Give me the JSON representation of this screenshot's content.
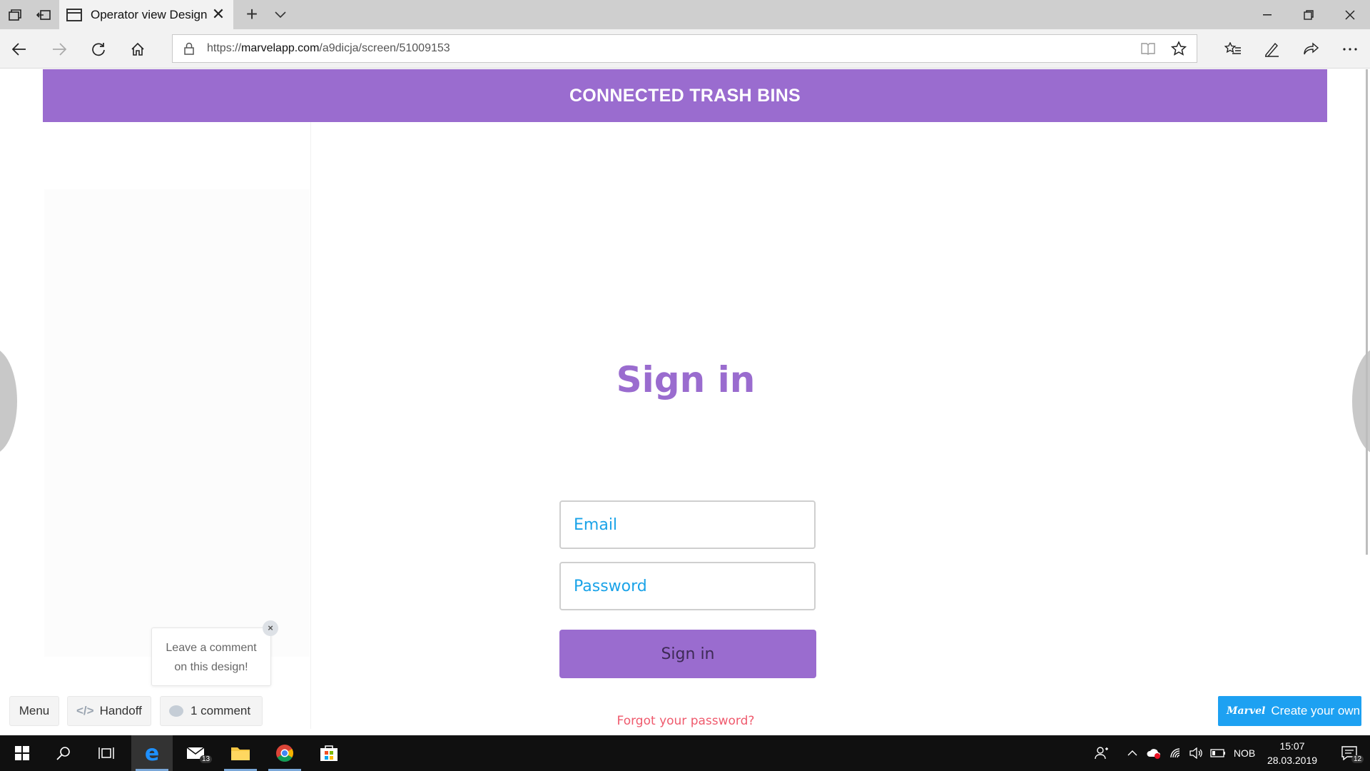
{
  "browser": {
    "tab_title": "Operator view Design",
    "url_prefix": "https://",
    "url_host": "marvelapp.com",
    "url_path": "/a9dicja/screen/51009153"
  },
  "app": {
    "header_title": "CONNECTED TRASH BINS",
    "signin_title": "Sign in",
    "email_placeholder": "Email",
    "password_placeholder": "Password",
    "signin_button": "Sign in",
    "forgot_link": "Forgot your password?"
  },
  "marvel": {
    "tooltip_line1": "Leave a comment",
    "tooltip_line2": "on this design!",
    "tooltip_close": "×",
    "menu_label": "Menu",
    "handoff_label": "Handoff",
    "comment_label": "1 comment",
    "create_own_logo": "Marvel",
    "create_own_label": "Create your own",
    "accent": "#1da1f2"
  },
  "taskbar": {
    "mail_badge": "13",
    "language": "NOB",
    "time": "15:07",
    "date": "28.03.2019",
    "notification_count": "12"
  },
  "colors": {
    "brand_purple": "#9a6ccf",
    "input_text": "#1aa3e8",
    "link_red": "#ef5a6d"
  }
}
